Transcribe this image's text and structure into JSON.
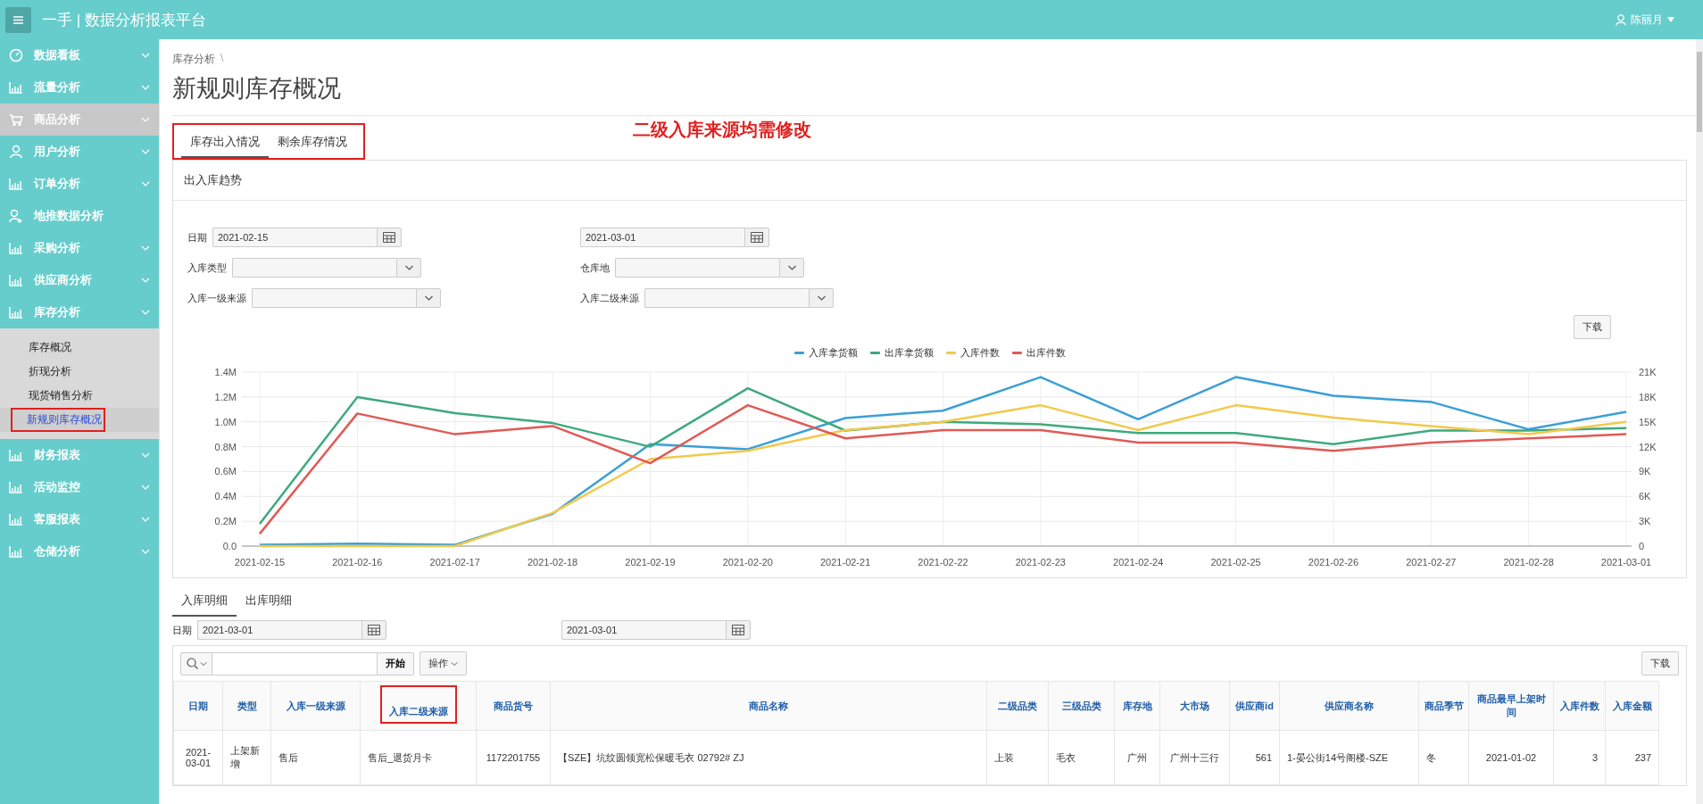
{
  "header": {
    "title": "一手 | 数据分析报表平台",
    "user": "陈丽月"
  },
  "sidebar": {
    "items": [
      {
        "label": "数据看板",
        "kind": "gauge",
        "expandable": true,
        "hovered": false
      },
      {
        "label": "流量分析",
        "kind": "chart",
        "expandable": true,
        "hovered": false
      },
      {
        "label": "商品分析",
        "kind": "cart",
        "expandable": true,
        "hovered": true
      },
      {
        "label": "用户分析",
        "kind": "user",
        "expandable": true,
        "hovered": false
      },
      {
        "label": "订单分析",
        "kind": "chart",
        "expandable": true,
        "hovered": false
      },
      {
        "label": "地推数据分析",
        "kind": "user-plus",
        "expandable": false,
        "hovered": false
      },
      {
        "label": "采购分析",
        "kind": "chart",
        "expandable": true,
        "hovered": false
      },
      {
        "label": "供应商分析",
        "kind": "chart",
        "expandable": true,
        "hovered": false
      },
      {
        "label": "库存分析",
        "kind": "chart",
        "expandable": true,
        "hovered": false,
        "expanded": true,
        "children": [
          {
            "label": "库存概况",
            "selected": false,
            "annotated": false
          },
          {
            "label": "折现分析",
            "selected": false,
            "annotated": false
          },
          {
            "label": "现货销售分析",
            "selected": false,
            "annotated": false
          },
          {
            "label": "新规则库存概况",
            "selected": true,
            "annotated": true
          }
        ]
      },
      {
        "label": "财务报表",
        "kind": "chart",
        "expandable": true,
        "hovered": false
      },
      {
        "label": "活动监控",
        "kind": "chart",
        "expandable": true,
        "hovered": false
      },
      {
        "label": "客服报表",
        "kind": "chart",
        "expandable": true,
        "hovered": false
      },
      {
        "label": "仓储分析",
        "kind": "chart",
        "expandable": true,
        "hovered": false
      }
    ]
  },
  "breadcrumb": {
    "parent": "库存分析",
    "separator": "\\"
  },
  "page_title": "新规则库存概况",
  "annotation_note": "二级入库来源均需修改",
  "tabs_annotated": true,
  "tabs": [
    {
      "label": "库存出入情况",
      "selected": true
    },
    {
      "label": "剩余库存情况",
      "selected": false
    }
  ],
  "trend_panel": {
    "title": "出入库趋势",
    "filters": [
      {
        "kind": "date",
        "label": "日期",
        "value": "2021-02-15"
      },
      {
        "kind": "date",
        "value": "2021-03-01"
      },
      {
        "kind": "select",
        "label": "入库类型"
      },
      {
        "kind": "select",
        "label": "仓库地"
      },
      {
        "kind": "select",
        "label": "入库一级来源"
      },
      {
        "kind": "select",
        "label": "入库二级来源"
      }
    ],
    "download": "下载",
    "chart_data": {
      "type": "line",
      "grid": true,
      "categories": [
        "2021-02-15",
        "2021-02-16",
        "2021-02-17",
        "2021-02-18",
        "2021-02-19",
        "2021-02-20",
        "2021-02-21",
        "2021-02-22",
        "2021-02-23",
        "2021-02-24",
        "2021-02-25",
        "2021-02-26",
        "2021-02-27",
        "2021-02-28",
        "2021-03-01"
      ],
      "ylim": [
        0,
        1400000
      ],
      "yticks": [
        {
          "value": 0,
          "label": "0.0"
        },
        {
          "value": 200000,
          "label": "0.2M"
        },
        {
          "value": 400000,
          "label": "0.4M"
        },
        {
          "value": 600000,
          "label": "0.6M"
        },
        {
          "value": 800000,
          "label": "0.8M"
        },
        {
          "value": 1000000,
          "label": "1.0M"
        },
        {
          "value": 1200000,
          "label": "1.2M"
        },
        {
          "value": 1400000,
          "label": "1.4M"
        }
      ],
      "y2lim": [
        0,
        21000
      ],
      "y2ticks": [
        {
          "value": 0,
          "label": "0"
        },
        {
          "value": 3000,
          "label": "3K"
        },
        {
          "value": 6000,
          "label": "6K"
        },
        {
          "value": 9000,
          "label": "9K"
        },
        {
          "value": 12000,
          "label": "12K"
        },
        {
          "value": 15000,
          "label": "15K"
        },
        {
          "value": 18000,
          "label": "18K"
        },
        {
          "value": 21000,
          "label": "21K"
        }
      ],
      "series": [
        {
          "name": "入库拿货额",
          "color": "#3a9fd6",
          "values": [
            10000,
            20000,
            10000,
            260000,
            820000,
            780000,
            1030000,
            1090000,
            1360000,
            1020000,
            1360000,
            1210000,
            1160000,
            940000,
            1080000
          ]
        },
        {
          "name": "出库拿货额",
          "color": "#3fa97f",
          "values": [
            180000,
            1200000,
            1070000,
            990000,
            800000,
            1270000,
            930000,
            1000000,
            980000,
            910000,
            910000,
            820000,
            930000,
            930000,
            950000
          ]
        },
        {
          "name": "入库件数",
          "color": "#f2c94c",
          "axis": "y2",
          "values": [
            0,
            0,
            0,
            4000,
            10500,
            11500,
            14000,
            15000,
            17000,
            14000,
            17000,
            15500,
            14500,
            13500,
            15000
          ]
        },
        {
          "name": "出库件数",
          "color": "#e05a55",
          "axis": "y2",
          "values": [
            1500,
            16000,
            13500,
            14500,
            10000,
            17000,
            13000,
            14000,
            14000,
            12500,
            12500,
            11500,
            12500,
            13000,
            13500
          ]
        }
      ]
    }
  },
  "detail_tabs": [
    {
      "label": "入库明细",
      "selected": true
    },
    {
      "label": "出库明细",
      "selected": false
    }
  ],
  "detail_dates": {
    "label": "日期",
    "from": "2021-03-01",
    "to": "2021-03-01"
  },
  "toolbar": {
    "go": "开始",
    "actions": "操作",
    "download": "下载"
  },
  "table": {
    "columns": [
      {
        "label": "日期",
        "annotated": false
      },
      {
        "label": "类型",
        "annotated": false
      },
      {
        "label": "入库一级来源",
        "annotated": false
      },
      {
        "label": "入库二级来源",
        "annotated": true
      },
      {
        "label": "商品货号",
        "annotated": false
      },
      {
        "label": "商品名称",
        "annotated": false
      },
      {
        "label": "二级品类",
        "annotated": false
      },
      {
        "label": "三级品类",
        "annotated": false
      },
      {
        "label": "库存地",
        "annotated": false
      },
      {
        "label": "大市场",
        "annotated": false
      },
      {
        "label": "供应商id",
        "annotated": false
      },
      {
        "label": "供应商名称",
        "annotated": false
      },
      {
        "label": "商品季节",
        "annotated": false
      },
      {
        "label": "商品最早上架时间",
        "annotated": false
      },
      {
        "label": "入库件数",
        "annotated": false
      },
      {
        "label": "入库金额",
        "annotated": false
      }
    ],
    "rows": [
      [
        "2021-03-01",
        "上架新增",
        "售后",
        "售后_退货月卡",
        "1172201755",
        "【SZE】坑纹圆领宽松保暖毛衣 02792# ZJ",
        "上装",
        "毛衣",
        "广州",
        "广州十三行",
        "561",
        "1-晏公街14号阁楼-SZE",
        "冬",
        "2021-01-02",
        "3",
        "237"
      ]
    ]
  }
}
